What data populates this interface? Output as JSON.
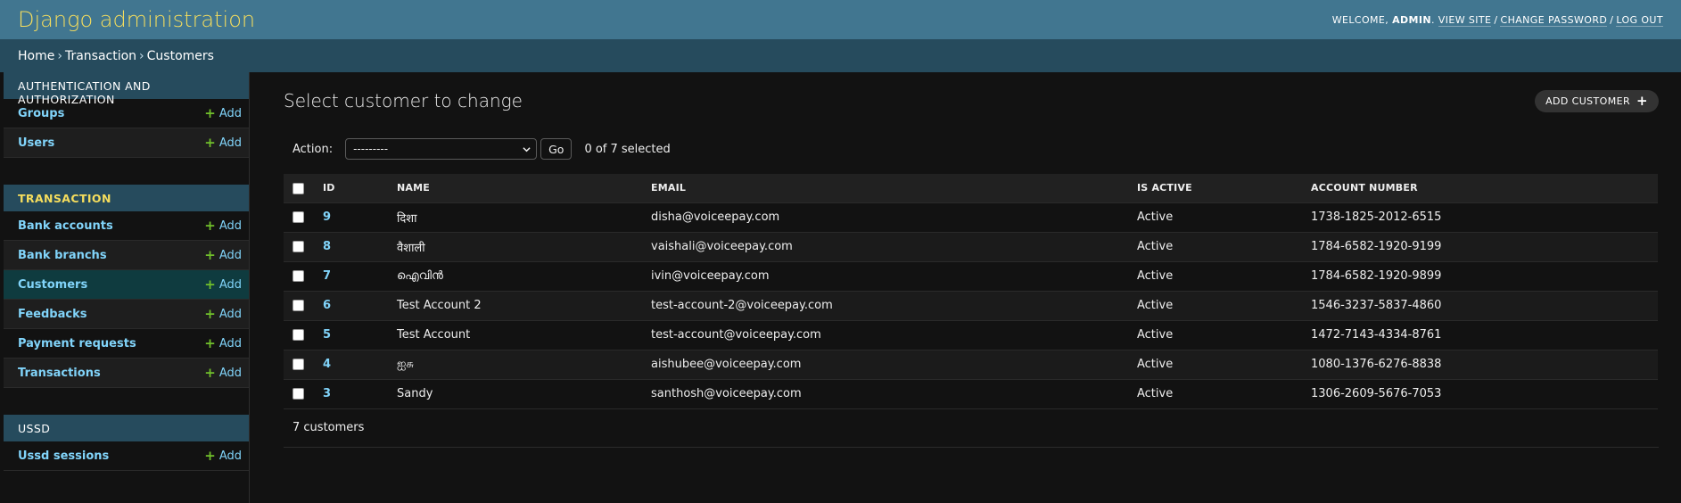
{
  "header": {
    "branding": "Django administration",
    "welcome": "Welcome,",
    "username": "admin",
    "view_site": "View site",
    "change_password": "Change password",
    "log_out": "Log out"
  },
  "breadcrumbs": {
    "home": "Home",
    "app": "Transaction",
    "current": "Customers",
    "separator": "›"
  },
  "sidebar": {
    "add_label": "Add",
    "modules": [
      {
        "title": "Authentication and Authorization",
        "items": [
          {
            "label": "Groups"
          },
          {
            "label": "Users"
          }
        ]
      },
      {
        "title": "Transaction",
        "items": [
          {
            "label": "Bank accounts"
          },
          {
            "label": "Bank branchs"
          },
          {
            "label": "Customers"
          },
          {
            "label": "Feedbacks"
          },
          {
            "label": "Payment requests"
          },
          {
            "label": "Transactions"
          }
        ]
      },
      {
        "title": "USSD",
        "items": [
          {
            "label": "Ussd sessions"
          }
        ]
      }
    ]
  },
  "content": {
    "title": "Select customer to change",
    "add_button": "Add customer",
    "actions": {
      "label": "Action:",
      "selected_value": "---------",
      "go_label": "Go",
      "selected_count": "0 of 7 selected"
    },
    "table": {
      "headers": [
        "ID",
        "Name",
        "Email",
        "Is active",
        "Account number"
      ],
      "rows": [
        {
          "id": "9",
          "name": "दिशा",
          "email": "disha@voiceepay.com",
          "active": "Active",
          "account": "1738-1825-2012-6515"
        },
        {
          "id": "8",
          "name": "वैशाली",
          "email": "vaishali@voiceepay.com",
          "active": "Active",
          "account": "1784-6582-1920-9199"
        },
        {
          "id": "7",
          "name": "ഐവിൻ",
          "email": "ivin@voiceepay.com",
          "active": "Active",
          "account": "1784-6582-1920-9899"
        },
        {
          "id": "6",
          "name": "Test Account 2",
          "email": "test-account-2@voiceepay.com",
          "active": "Active",
          "account": "1546-3237-5837-4860"
        },
        {
          "id": "5",
          "name": "Test Account",
          "email": "test-account@voiceepay.com",
          "active": "Active",
          "account": "1472-7143-4334-8761"
        },
        {
          "id": "4",
          "name": "ஐசு",
          "email": "aishubee@voiceepay.com",
          "active": "Active",
          "account": "1080-1376-6276-8838"
        },
        {
          "id": "3",
          "name": "Sandy",
          "email": "santhosh@voiceepay.com",
          "active": "Active",
          "account": "1306-2609-5676-7053"
        }
      ]
    },
    "paginator": "7 customers"
  }
}
